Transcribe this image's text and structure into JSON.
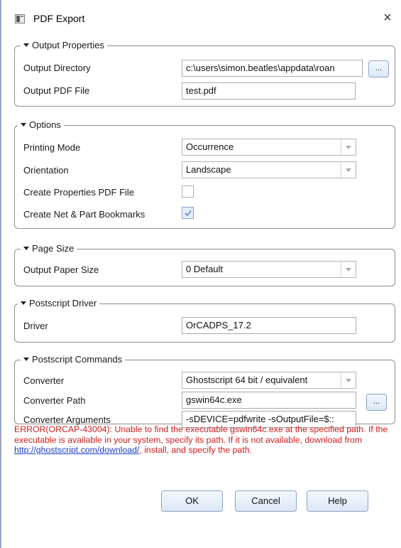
{
  "window": {
    "title": "PDF Export",
    "close_glyph": "×"
  },
  "groups": {
    "output_properties": {
      "legend": "Output Properties",
      "output_directory": {
        "label": "Output Directory",
        "value": "c:\\users\\simon.beatles\\appdata\\roan"
      },
      "output_pdf_file": {
        "label": "Output PDF File",
        "value": "test.pdf"
      },
      "browse_label": "..."
    },
    "options": {
      "legend": "Options",
      "printing_mode": {
        "label": "Printing Mode",
        "value": "Occurrence"
      },
      "orientation": {
        "label": "Orientation",
        "value": "Landscape"
      },
      "create_properties_pdf": {
        "label": "Create Properties PDF File",
        "checked": false
      },
      "create_bookmarks": {
        "label": "Create Net & Part Bookmarks",
        "checked": true
      }
    },
    "page_size": {
      "legend": "Page Size",
      "output_paper_size": {
        "label": "Output Paper Size",
        "value": "0 Default"
      }
    },
    "postscript_driver": {
      "legend": "Postscript Driver",
      "driver": {
        "label": "Driver",
        "value": "OrCADPS_17.2"
      }
    },
    "postscript_commands": {
      "legend": "Postscript Commands",
      "converter": {
        "label": "Converter",
        "value": "Ghostscript 64 bit / equivalent"
      },
      "converter_path": {
        "label": "Converter Path",
        "value": "gswin64c.exe"
      },
      "converter_arguments": {
        "label": "Converter Arguments",
        "value": "-sDEVICE=pdfwrite -sOutputFile=$::"
      },
      "browse_label": "..."
    }
  },
  "error": {
    "text_before_link": "ERROR(ORCAP-43004): Unable to find the executable gswin64c.exe at the specified path. If the executable is available in your system, specify its path. If it is not available, download from ",
    "link": "http://ghostscript.com/download/",
    "text_after_link": ", install, and specify the path.",
    "color": "#d11a1a"
  },
  "buttons": {
    "ok": "OK",
    "cancel": "Cancel",
    "help": "Help"
  },
  "icons": {
    "app": "pdf-export-app-icon",
    "close": "close-icon",
    "checkmark": "checkmark-icon",
    "collapse": "collapse-triangle-icon"
  }
}
